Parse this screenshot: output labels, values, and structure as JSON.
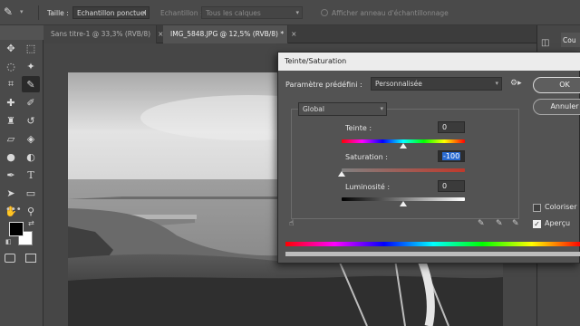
{
  "options_bar": {
    "taille_label": "Taille :",
    "taille_value": "Echantillon ponctuel",
    "echantillon_label": "Echantillon :",
    "echantillon_value": "Tous les calques",
    "ring_label": "Afficher anneau d'échantillonnage"
  },
  "tabs": [
    {
      "label": "Sans titre-1 @ 33,3% (RVB/8)",
      "close": "×"
    },
    {
      "label": "IMG_5848.JPG @ 12,5% (RVB/8) *",
      "close": "×"
    }
  ],
  "right_panel": {
    "tab_label": "Cou"
  },
  "dialog": {
    "title": "Teinte/Saturation",
    "preset_label": "Paramètre prédéfini :",
    "preset_value": "Personnalisée",
    "channel_value": "Global",
    "hue_label": "Teinte :",
    "hue_value": "0",
    "saturation_label": "Saturation :",
    "saturation_value": "-100",
    "lightness_label": "Luminosité :",
    "lightness_value": "0",
    "ok_label": "OK",
    "cancel_label": "Annuler",
    "colorize_label": "Coloriser",
    "colorize_checked": false,
    "preview_label": "Aperçu",
    "preview_checked": true,
    "slider_fractions": {
      "hue": 0.5,
      "saturation": 0.0,
      "lightness": 0.5
    }
  },
  "colors": {
    "ui_dark": "#535353",
    "highlight": "#2a6bd1",
    "dialog_title_bg": "#ececec"
  }
}
